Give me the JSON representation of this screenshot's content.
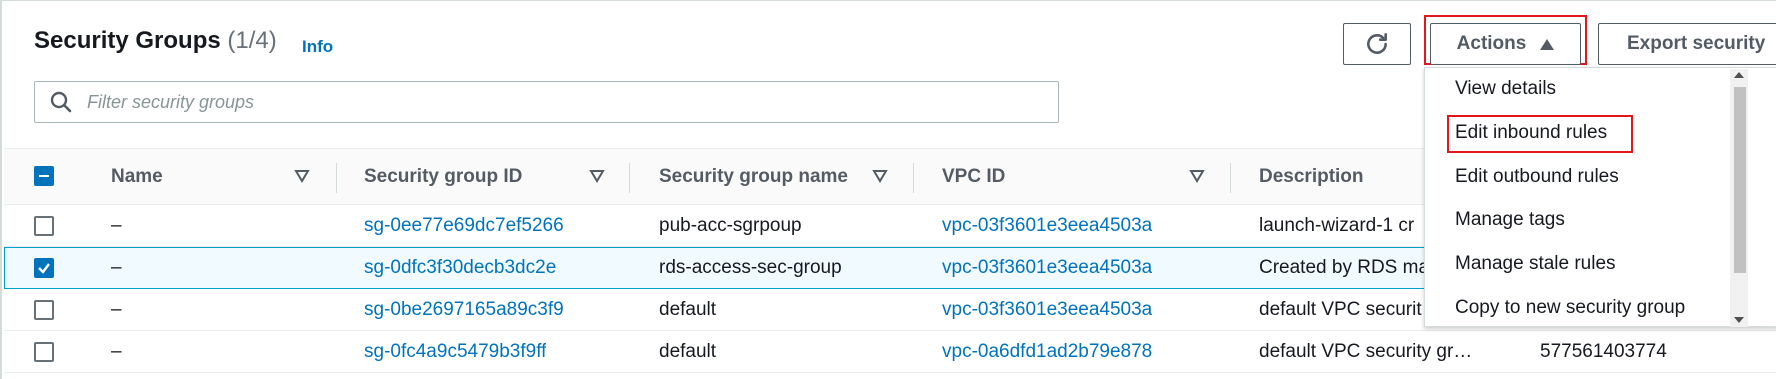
{
  "header": {
    "title": "Security Groups",
    "count": "(1/4)",
    "info": "Info"
  },
  "toolbar": {
    "refresh_icon": "refresh-icon",
    "actions_label": "Actions",
    "export_label": "Export security"
  },
  "search": {
    "placeholder": "Filter security groups"
  },
  "table": {
    "columns": [
      "Name",
      "Security group ID",
      "Security group name",
      "VPC ID",
      "Description"
    ],
    "rows": [
      {
        "checked": false,
        "name": "–",
        "sg_id": "sg-0ee77e69dc7ef5266",
        "sg_name": "pub-acc-sgrpoup",
        "vpc_id": "vpc-03f3601e3eea4503a",
        "description": "launch-wizard-1 cr",
        "owner": ""
      },
      {
        "checked": true,
        "name": "–",
        "sg_id": "sg-0dfc3f30decb3dc2e",
        "sg_name": "rds-access-sec-group",
        "vpc_id": "vpc-03f3601e3eea4503a",
        "description": "Created by RDS ma",
        "owner": ""
      },
      {
        "checked": false,
        "name": "–",
        "sg_id": "sg-0be2697165a89c3f9",
        "sg_name": "default",
        "vpc_id": "vpc-03f3601e3eea4503a",
        "description": "default VPC securit",
        "owner": ""
      },
      {
        "checked": false,
        "name": "–",
        "sg_id": "sg-0fc4a9c5479b3f9ff",
        "sg_name": "default",
        "vpc_id": "vpc-0a6dfd1ad2b79e878",
        "description": "default VPC security gr…",
        "owner": "577561403774"
      }
    ]
  },
  "actions_menu": {
    "items": [
      "View details",
      "Edit inbound rules",
      "Edit outbound rules",
      "Manage tags",
      "Manage stale rules",
      "Copy to new security group"
    ],
    "highlighted": "Edit inbound rules"
  },
  "colors": {
    "link": "#0073bb",
    "highlight_box": "#e4161b",
    "selected_row_border": "#00a1c9",
    "selected_row_bg": "#f1faff"
  }
}
